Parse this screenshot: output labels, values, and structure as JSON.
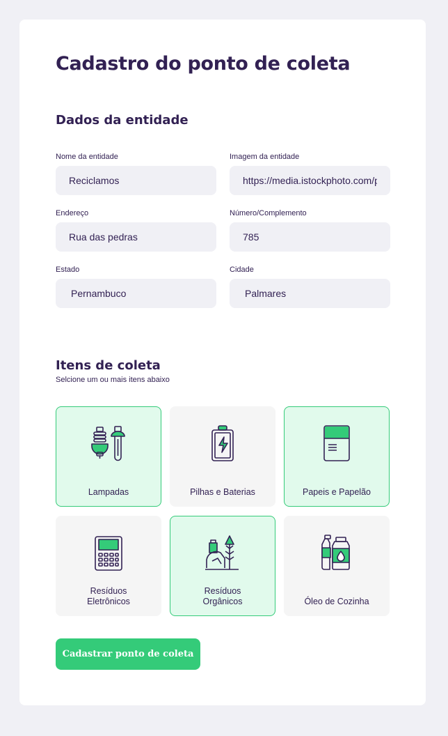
{
  "page": {
    "title": "Cadastro do ponto de coleta"
  },
  "entity_section": {
    "heading": "Dados da entidade",
    "fields": {
      "name": {
        "label": "Nome da entidade",
        "value": "Reciclamos"
      },
      "image": {
        "label": "Imagem da entidade",
        "value": "https://media.istockphoto.com/ph"
      },
      "address": {
        "label": "Endereço",
        "value": "Rua das pedras"
      },
      "number": {
        "label": "Número/Complemento",
        "value": "785"
      },
      "state": {
        "label": "Estado",
        "value": "Pernambuco"
      },
      "city": {
        "label": "Cidade",
        "value": "Palmares"
      }
    }
  },
  "items_section": {
    "heading": "Itens de coleta",
    "subtitle": "Selcione um ou mais itens abaixo",
    "items": [
      {
        "label": "Lampadas",
        "icon": "lamp-icon",
        "selected": true
      },
      {
        "label": "Pilhas e Baterias",
        "icon": "battery-icon",
        "selected": false
      },
      {
        "label": "Papeis e Papelão",
        "icon": "paper-icon",
        "selected": true
      },
      {
        "label": "Resíduos\nEletrônicos",
        "icon": "electronics-icon",
        "selected": false
      },
      {
        "label": "Resíduos\nOrgânicos",
        "icon": "organic-icon",
        "selected": true
      },
      {
        "label": "Óleo de Cozinha",
        "icon": "oil-icon",
        "selected": false
      }
    ]
  },
  "submit": {
    "label": "Cadastrar ponto de coleta"
  },
  "colors": {
    "accent": "#34cb79",
    "selected_bg": "#e1faec",
    "text": "#322153",
    "input_bg": "#f0f0f5"
  }
}
